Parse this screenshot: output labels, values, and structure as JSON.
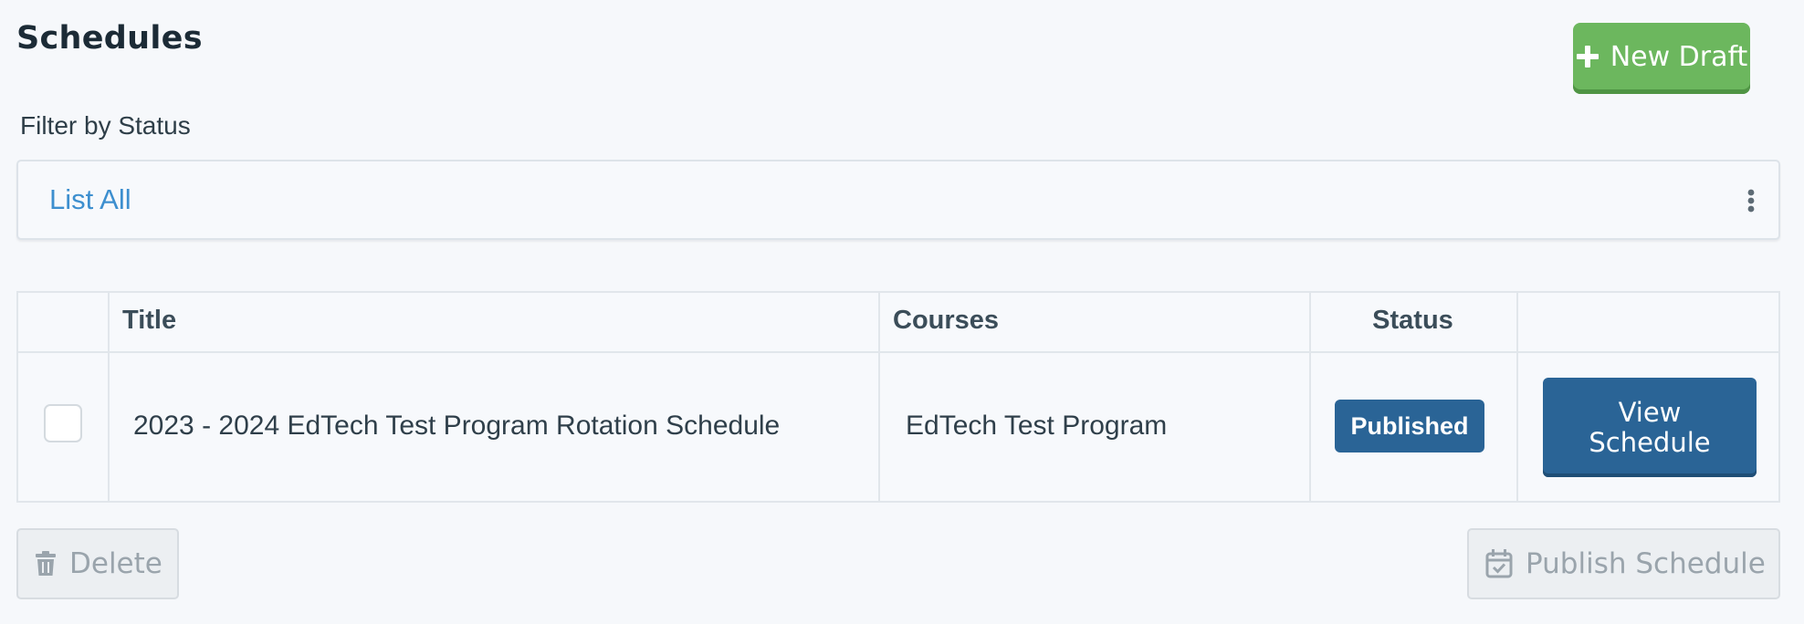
{
  "header": {
    "title": "Schedules",
    "new_draft_label": "New Draft"
  },
  "filter": {
    "label": "Filter by Status",
    "value": "List All"
  },
  "table": {
    "columns": [
      "Title",
      "Courses",
      "Status"
    ],
    "rows": [
      {
        "title": "2023 - 2024 EdTech Test Program Rotation Schedule",
        "courses": "EdTech Test Program",
        "status": "Published",
        "action_label": "View\nSchedule",
        "checked": false
      }
    ]
  },
  "footer": {
    "delete_label": "Delete",
    "publish_label": "Publish Schedule"
  },
  "colors": {
    "primary": "#2a6496",
    "success": "#6cb75e",
    "link": "#3d8fcf",
    "disabled_text": "#9aa4ac"
  },
  "icons": {
    "new_draft": "plus-icon",
    "filter_menu": "more-vertical-icon",
    "delete": "trash-icon",
    "publish": "calendar-check-icon"
  }
}
